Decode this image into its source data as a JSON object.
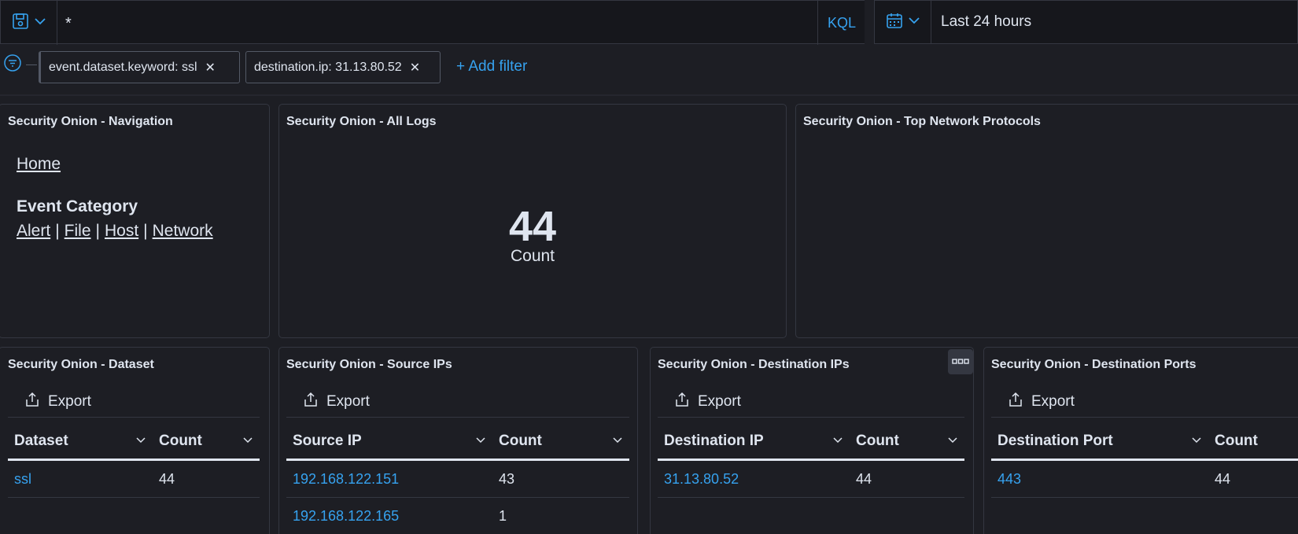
{
  "query_bar": {
    "query": "*",
    "language": "KQL",
    "time_range": "Last 24 hours"
  },
  "filters": {
    "pills": [
      {
        "label": "event.dataset.keyword: ssl"
      },
      {
        "label": "destination.ip: 31.13.80.52"
      }
    ],
    "add_filter": "+ Add filter"
  },
  "panels": {
    "navigation": {
      "title": "Security Onion - Navigation",
      "home": "Home",
      "category_heading": "Event Category",
      "links": [
        "Alert",
        "File",
        "Host",
        "Network"
      ],
      "separator": "|"
    },
    "all_logs": {
      "title": "Security Onion - All Logs",
      "value": "44",
      "label": "Count"
    },
    "top_protocols": {
      "title": "Security Onion - Top Network Protocols"
    },
    "dataset": {
      "title": "Security Onion - Dataset",
      "export": "Export",
      "columns": [
        "Dataset",
        "Count"
      ],
      "rows": [
        [
          "ssl",
          "44"
        ]
      ]
    },
    "source_ips": {
      "title": "Security Onion - Source IPs",
      "export": "Export",
      "columns": [
        "Source IP",
        "Count"
      ],
      "rows": [
        [
          "192.168.122.151",
          "43"
        ],
        [
          "192.168.122.165",
          "1"
        ]
      ]
    },
    "destination_ips": {
      "title": "Security Onion - Destination IPs",
      "export": "Export",
      "columns": [
        "Destination IP",
        "Count"
      ],
      "rows": [
        [
          "31.13.80.52",
          "44"
        ]
      ]
    },
    "destination_ports": {
      "title": "Security Onion - Destination Ports",
      "export": "Export",
      "columns": [
        "Destination Port",
        "Count"
      ],
      "rows": [
        [
          "443",
          "44"
        ]
      ]
    }
  },
  "colors": {
    "background": "#1d1e24",
    "accent_link": "#36a2ef",
    "border": "#343741"
  }
}
